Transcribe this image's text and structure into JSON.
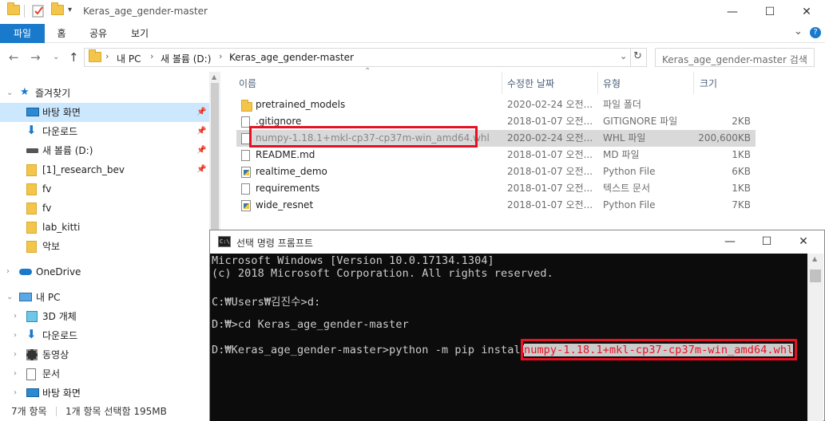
{
  "window": {
    "title": "Keras_age_gender-master",
    "minimize": "—",
    "maximize": "☐",
    "close": "✕"
  },
  "ribbon": {
    "tabs": [
      "파일",
      "홈",
      "공유",
      "보기"
    ],
    "collapse": "⌄",
    "help": "?"
  },
  "address": {
    "crumbs": [
      "내 PC",
      "새 볼륨 (D:)",
      "Keras_age_gender-master"
    ],
    "search_placeholder": "Keras_age_gender-master 검색"
  },
  "nav": {
    "quick_access": "즐겨찾기",
    "pinned": [
      "바탕 화면",
      "다운로드",
      "새 볼륨 (D:)",
      "[1]_research_bev"
    ],
    "folders": [
      "fv",
      "fv",
      "lab_kitti",
      "악보"
    ],
    "onedrive": "OneDrive",
    "this_pc": "내 PC",
    "pc_items": [
      "3D 개체",
      "다운로드",
      "동영상",
      "문서",
      "바탕 화면"
    ]
  },
  "columns": {
    "name": "이름",
    "date": "수정한 날짜",
    "type": "유형",
    "size": "크기"
  },
  "files": [
    {
      "name": "pretrained_models",
      "date": "2020-02-24 오전...",
      "type": "파일 폴더",
      "size": "",
      "icon": "folder-icon"
    },
    {
      "name": ".gitignore",
      "date": "2018-01-07 오전...",
      "type": "GITIGNORE 파일",
      "size": "2KB",
      "icon": "file-icon"
    },
    {
      "name": "numpy-1.18.1+mkl-cp37-cp37m-win_amd64.whl",
      "date": "2020-02-24 오전...",
      "type": "WHL 파일",
      "size": "200,600KB",
      "icon": "file-icon"
    },
    {
      "name": "README.md",
      "date": "2018-01-07 오전...",
      "type": "MD 파일",
      "size": "1KB",
      "icon": "file-icon"
    },
    {
      "name": "realtime_demo",
      "date": "2018-01-07 오전...",
      "type": "Python File",
      "size": "6KB",
      "icon": "python-file-icon"
    },
    {
      "name": "requirements",
      "date": "2018-01-07 오전...",
      "type": "텍스트 문서",
      "size": "1KB",
      "icon": "text-file-icon"
    },
    {
      "name": "wide_resnet",
      "date": "2018-01-07 오전...",
      "type": "Python File",
      "size": "7KB",
      "icon": "python-file-icon"
    }
  ],
  "status": {
    "count": "7개 항목",
    "selected": "1개 항목 선택함 195MB"
  },
  "cmd": {
    "title": "선택 명령 프롬프트",
    "icon_label": "C:\\",
    "lines": [
      "Microsoft Windows [Version 10.0.17134.1304]",
      "(c) 2018 Microsoft Corporation. All rights reserved.",
      "",
      "C:₩Users₩김진수>d:",
      "",
      "D:₩>cd Keras_age_gender-master",
      "",
      "D:₩Keras_age_gender-master>python -m pip install "
    ],
    "selected_text": "numpy-1.18.1+mkl-cp37-cp37m-win_amd64.whl"
  },
  "colors": {
    "accent": "#1979ca",
    "highlight": "#e81123",
    "selection": "#cce8ff"
  }
}
